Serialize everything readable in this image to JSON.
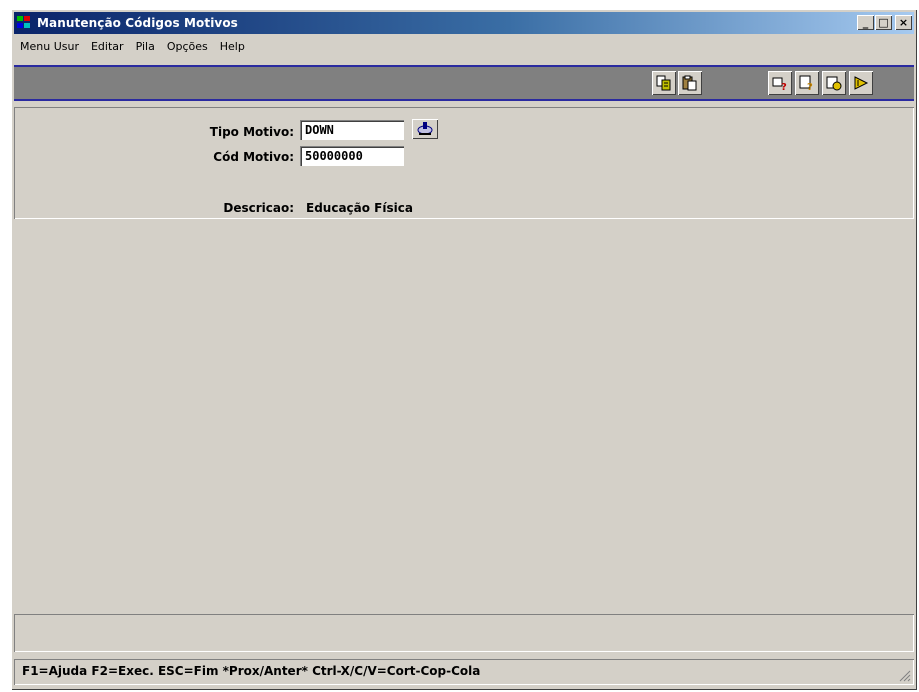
{
  "window": {
    "title": "Manutenção Códigos Motivos",
    "buttons": {
      "minimize": "_",
      "maximize": "□",
      "close": "×"
    }
  },
  "menubar": {
    "items": [
      {
        "label": "Menu Usur"
      },
      {
        "label": "Editar"
      },
      {
        "label": "Pila"
      },
      {
        "label": "Opções"
      },
      {
        "label": "Help"
      }
    ]
  },
  "toolbar": {
    "buttons": [
      {
        "icon": "copy-record-icon"
      },
      {
        "icon": "paste-record-icon"
      },
      {
        "icon": "query-icon"
      },
      {
        "icon": "query-execute-icon"
      },
      {
        "icon": "cancel-query-icon"
      },
      {
        "icon": "exit-icon"
      }
    ]
  },
  "form": {
    "tipo_motivo": {
      "label": "Tipo Motivo:",
      "value": "DOWN"
    },
    "cod_motivo": {
      "label": "Cód Motivo:",
      "value": "50000000"
    },
    "descricao": {
      "label": "Descricao:",
      "value": "Educação Física"
    }
  },
  "statusbar": {
    "text": "F1=Ajuda F2=Exec. ESC=Fim *Prox/Anter* Ctrl-X/C/V=Cort-Cop-Cola"
  },
  "colors": {
    "title_gradient_start": "#0a246a",
    "title_gradient_end": "#a6caf0",
    "toolbar_bg": "#808080",
    "toolbar_border": "#2a2aa0",
    "face": "#d4d0c8"
  }
}
